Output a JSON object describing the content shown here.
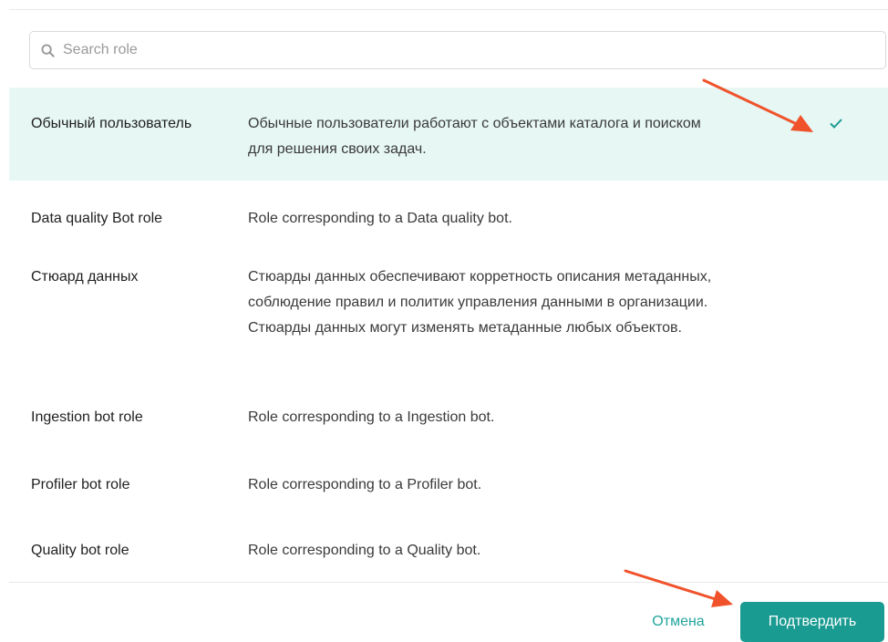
{
  "search": {
    "placeholder": "Search role"
  },
  "roles": [
    {
      "name": "Обычный пользователь",
      "desc_lines": [
        "Обычные пользователи работают с объектами каталога и поиском",
        "для решения своих задач."
      ],
      "selected": true
    },
    {
      "name": "Data quality Bot role",
      "desc_lines": [
        "Role corresponding to a Data quality bot."
      ],
      "selected": false
    },
    {
      "name": "Стюард данных",
      "desc_lines": [
        "Стюарды данных обеспечивают корретность описания метаданных,",
        "соблюдение правил и политик управления данными в организации.",
        "Стюарды данных могут изменять метаданные любых объектов."
      ],
      "selected": false
    },
    {
      "name": "Ingestion bot role",
      "desc_lines": [
        "Role corresponding to a Ingestion bot."
      ],
      "selected": false
    },
    {
      "name": "Profiler bot role",
      "desc_lines": [
        "Role corresponding to a Profiler bot."
      ],
      "selected": false
    },
    {
      "name": "Quality bot role",
      "desc_lines": [
        "Role corresponding to a Quality bot."
      ],
      "selected": false
    }
  ],
  "footer": {
    "cancel_label": "Отмена",
    "confirm_label": "Подтвердить"
  },
  "icons": {
    "search": "search-icon",
    "check": "check-icon"
  },
  "colors": {
    "accent": "#1a9b91",
    "selected_bg": "#e6f7f4",
    "annotation_arrow": "#f0532b"
  }
}
